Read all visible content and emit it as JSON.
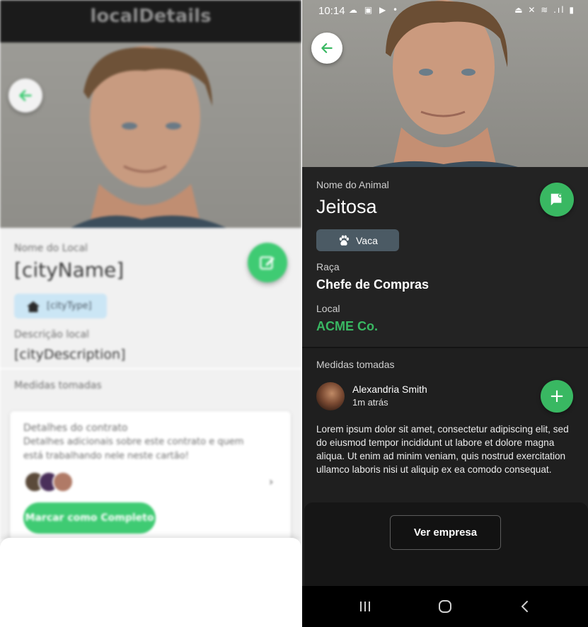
{
  "left_screen": {
    "app_title": "localDetails",
    "city_label": "Nome do Local",
    "city_name": "[cityName]",
    "city_type": "[cityType]",
    "description_label": "Descrição local",
    "description_value": "[cityDescription]",
    "measures_label": "Medidas tomadas",
    "contract": {
      "title": "Detalhes do contrato",
      "description": "Detalhes adicionais sobre este contrato e quem está trabalhando nele neste cartão!",
      "complete_button": "Marcar como Completo"
    }
  },
  "right_screen": {
    "status_bar": {
      "time": "10:14",
      "left_icons": "☁ ▣ ▶ •",
      "right_icons": "⏏ ✕ ≋ .ıl ▮"
    },
    "animal_label": "Nome do Animal",
    "animal_name": "Jeitosa",
    "animal_type": "Vaca",
    "breed_label": "Raça",
    "breed_value": "Chefe de Compras",
    "location_label": "Local",
    "location_value": "ACME Co.",
    "measures_label": "Medidas tomadas",
    "comment": {
      "user": "Alexandria Smith",
      "time": "1m atrás",
      "text": "Lorem ipsum dolor sit amet, consectetur adipiscing elit, sed do eiusmod tempor incididunt ut labore et dolore magna aliqua. Ut enim ad minim veniam, quis nostrud exercitation ullamco laboris nisi ut aliquip ex ea comodo consequat."
    },
    "company_button": "Ver empresa"
  },
  "colors": {
    "accent_green": "#39b862",
    "chip_dark": "#4b5a64",
    "chip_light": "#cbe6f5"
  }
}
